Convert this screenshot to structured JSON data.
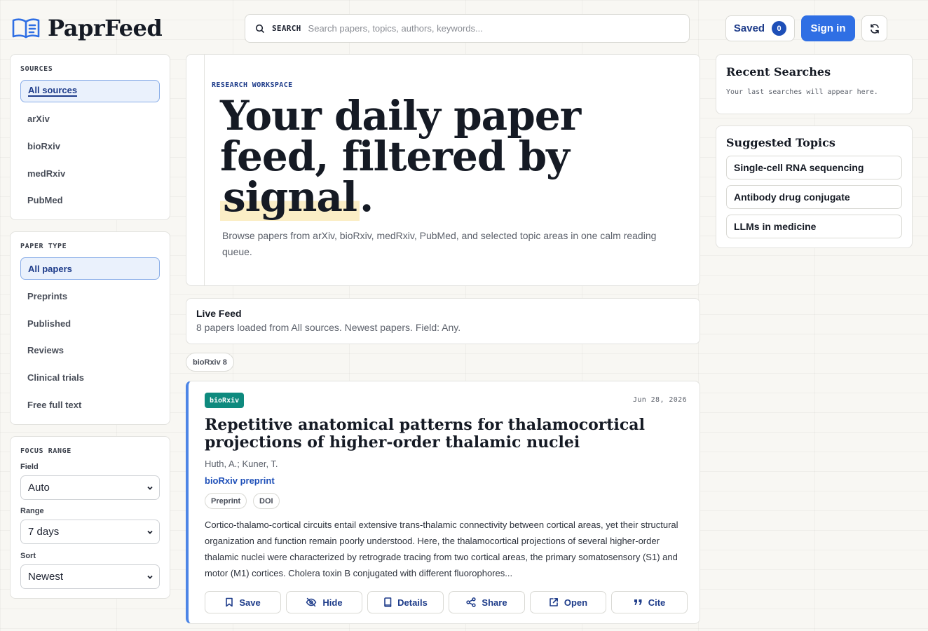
{
  "app": {
    "name": "PaprFeed"
  },
  "search": {
    "label": "SEARCH",
    "placeholder": "Search papers, topics, authors, keywords..."
  },
  "header": {
    "saved_label": "Saved",
    "saved_count": "0",
    "signin_label": "Sign in"
  },
  "sources": {
    "title": "SOURCES",
    "items": [
      {
        "label": "All sources",
        "active": true
      },
      {
        "label": "arXiv"
      },
      {
        "label": "bioRxiv"
      },
      {
        "label": "medRxiv"
      },
      {
        "label": "PubMed"
      }
    ]
  },
  "paper_type": {
    "title": "PAPER TYPE",
    "items": [
      {
        "label": "All papers",
        "active": true
      },
      {
        "label": "Preprints"
      },
      {
        "label": "Published"
      },
      {
        "label": "Reviews"
      },
      {
        "label": "Clinical trials"
      },
      {
        "label": "Free full text"
      }
    ]
  },
  "focus": {
    "title": "FOCUS RANGE",
    "field_label": "Field",
    "field_value": "Auto",
    "range_label": "Range",
    "range_value": "7 days",
    "sort_label": "Sort",
    "sort_value": "Newest"
  },
  "hero": {
    "eyebrow": "RESEARCH WORKSPACE",
    "title_part1": "Your daily paper feed, filtered by ",
    "title_highlight": "signal",
    "title_end": ".",
    "description": "Browse papers from arXiv, bioRxiv, medRxiv, PubMed, and selected topic areas in one calm reading queue."
  },
  "live_feed": {
    "title": "Live Feed",
    "subtitle": "8 papers loaded from All sources. Newest papers. Field: Any."
  },
  "source_chip": "bioRxiv 8",
  "paper": {
    "source": "bioRxiv",
    "date": "Jun 28, 2026",
    "title": "Repetitive anatomical patterns for thalamocortical projections of higher-order thalamic nuclei",
    "authors": "Huth, A.; Kuner, T.",
    "venue": "bioRxiv preprint",
    "tags": [
      "Preprint",
      "DOI"
    ],
    "abstract": "Cortico-thalamo-cortical circuits entail extensive trans-thalamic connectivity between cortical areas, yet their structural organization and function remain poorly understood. Here, the thalamocortical projections of several higher-order thalamic nuclei were characterized by retrograde tracing from two cortical areas, the primary somatosensory (S1) and motor (M1) cortices. Cholera toxin B conjugated with different fluorophores...",
    "actions": {
      "save": "Save",
      "hide": "Hide",
      "details": "Details",
      "share": "Share",
      "open": "Open",
      "cite": "Cite"
    }
  },
  "recent": {
    "title": "Recent Searches",
    "note": "Your last searches will appear here."
  },
  "suggested": {
    "title": "Suggested Topics",
    "items": [
      "Single-cell RNA sequencing",
      "Antibody drug conjugate",
      "LLMs in medicine"
    ]
  },
  "colors": {
    "accent": "#2f6fe4",
    "brand": "#1e3c8a",
    "source_tag": "#0e8a7e",
    "highlight": "#fbeec6"
  }
}
